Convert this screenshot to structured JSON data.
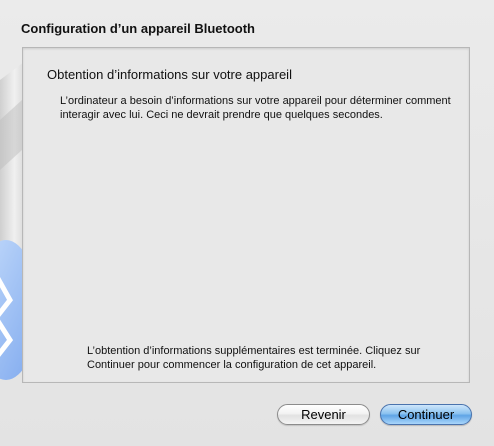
{
  "window": {
    "title": "Configuration d’un appareil Bluetooth"
  },
  "panel": {
    "heading": "Obtention d’informations sur votre appareil",
    "description": "L’ordinateur a besoin d’informations sur votre appareil pour déterminer comment interagir avec lui. Ceci ne devrait prendre que quelques secondes.",
    "status": "L’obtention d’informations supplémentaires est terminée. Cliquez sur Continuer pour commencer la configuration de cet appareil."
  },
  "buttons": {
    "back_label": "Revenir",
    "continue_label": "Continuer"
  },
  "icons": {
    "background_graphic": "bluetooth-icon"
  },
  "colors": {
    "default_button": "#8cc3f0",
    "bluetooth_badge": "#8ab4f3"
  }
}
